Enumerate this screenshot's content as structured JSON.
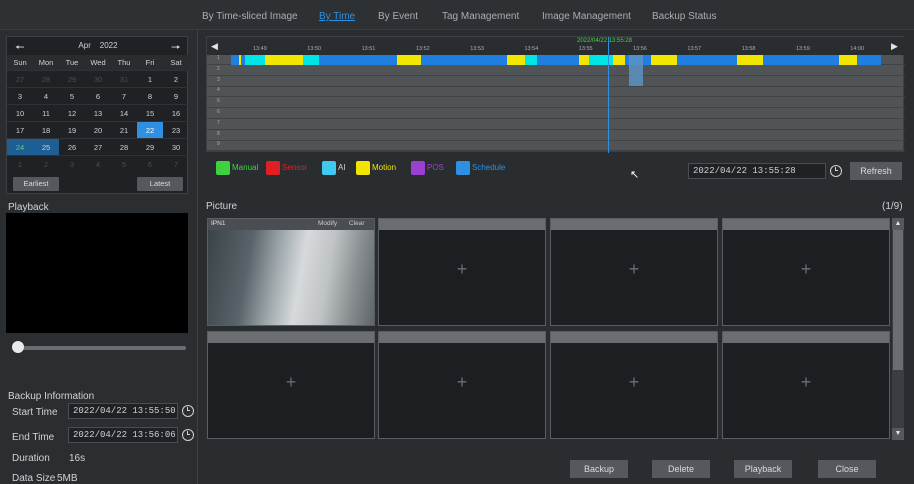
{
  "nav": {
    "tabs": [
      {
        "label": "By Time-sliced Image",
        "active": false
      },
      {
        "label": "By Time",
        "active": true
      },
      {
        "label": "By Event",
        "active": false
      },
      {
        "label": "Tag Management",
        "active": false
      },
      {
        "label": "Image Management",
        "active": false
      },
      {
        "label": "Backup Status",
        "active": false
      }
    ]
  },
  "calendar": {
    "month": "Apr",
    "year": "2022",
    "dow": [
      "Sun",
      "Mon",
      "Tue",
      "Wed",
      "Thu",
      "Fri",
      "Sat"
    ],
    "days": [
      "27",
      "28",
      "29",
      "30",
      "31",
      "1",
      "2",
      "3",
      "4",
      "5",
      "6",
      "7",
      "8",
      "9",
      "10",
      "11",
      "12",
      "13",
      "14",
      "15",
      "16",
      "17",
      "18",
      "19",
      "20",
      "21",
      "22",
      "23",
      "24",
      "25",
      "26",
      "27",
      "28",
      "29",
      "30",
      "1",
      "2",
      "3",
      "4",
      "5",
      "6",
      "7"
    ],
    "earliest_label": "Earliest",
    "latest_label": "Latest"
  },
  "playback": {
    "label": "Playback"
  },
  "backup_info": {
    "title": "Backup Information",
    "start_label": "Start Time",
    "start_value": "2022/04/22 13:55:50",
    "end_label": "End Time",
    "end_value": "2022/04/22 13:56:06",
    "duration_label": "Duration",
    "duration_value": "16s",
    "size_label": "Data Size",
    "size_value": "5MB"
  },
  "timeline": {
    "current_time": "2022/04/22 13:55:28",
    "ticks": [
      "13:49",
      "13:50",
      "13:51",
      "13:52",
      "13:53",
      "13:54",
      "13:55",
      "13:56",
      "13:57",
      "13:58",
      "13:59",
      "14:00"
    ],
    "rows": [
      "1",
      "2",
      "3",
      "4",
      "5",
      "6",
      "7",
      "8",
      "9"
    ],
    "colors": {
      "schedule": "#1e7fe0",
      "motion": "#f2e600",
      "manual": "#00e5e5"
    }
  },
  "legend": {
    "items": [
      {
        "label": "Manual",
        "color": "#3fd23f"
      },
      {
        "label": "Sensor",
        "color": "#e02020"
      },
      {
        "label": "AI",
        "color": "#3fc8f0"
      },
      {
        "label": "Motion",
        "color": "#f2e600"
      },
      {
        "label": "POS",
        "color": "#9b3fd0"
      },
      {
        "label": "Schedule",
        "color": "#2f8fe0"
      }
    ],
    "datetime_value": "2022/04/22 13:55:28",
    "refresh_label": "Refresh"
  },
  "picture": {
    "label": "Picture",
    "page": "(1/9)",
    "first_cell": {
      "title": "IPN1",
      "modify": "Modify",
      "clear": "Clear"
    },
    "plus": "+"
  },
  "actions": {
    "backup": "Backup",
    "delete": "Delete",
    "playback": "Playback",
    "close": "Close"
  }
}
